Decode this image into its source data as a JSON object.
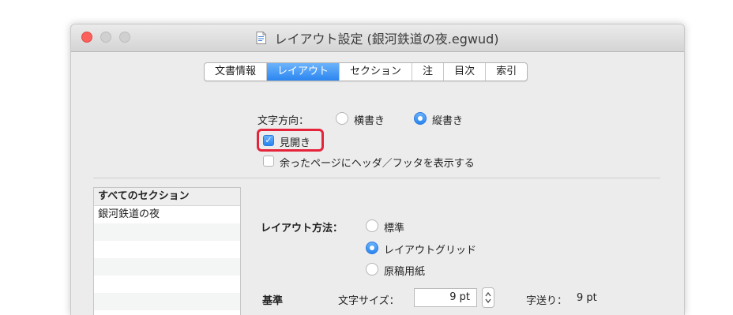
{
  "window": {
    "title": "レイアウト設定 (銀河鉄道の夜.egwud)",
    "doc_icon": "document-icon"
  },
  "tabs": [
    {
      "label": "文書情報",
      "active": false
    },
    {
      "label": "レイアウト",
      "active": true
    },
    {
      "label": "セクション",
      "active": false
    },
    {
      "label": "注",
      "active": false
    },
    {
      "label": "目次",
      "active": false
    },
    {
      "label": "索引",
      "active": false
    }
  ],
  "text_direction": {
    "label": "文字方向：",
    "options": [
      {
        "label": "横書き",
        "selected": false
      },
      {
        "label": "縦書き",
        "selected": true
      }
    ]
  },
  "checkboxes": {
    "spread": {
      "label": "見開き",
      "checked": true
    },
    "header_footer": {
      "label": "余ったページにヘッダ／フッタを表示する",
      "checked": false
    }
  },
  "section_list": {
    "header": "すべてのセクション",
    "items": [
      "銀河鉄道の夜"
    ]
  },
  "layout_method": {
    "label": "レイアウト方法：",
    "options": [
      {
        "label": "標準",
        "selected": false
      },
      {
        "label": "レイアウトグリッド",
        "selected": true
      },
      {
        "label": "原稿用紙",
        "selected": false
      }
    ]
  },
  "base": {
    "label": "基準",
    "char_size_label": "文字サイズ：",
    "char_size_value": "9 pt",
    "char_advance_label": "字送り：",
    "char_advance_value": "9 pt"
  },
  "colors": {
    "accent": "#2b86f0",
    "highlight": "#e5243b",
    "close_button": "#fc605c"
  }
}
